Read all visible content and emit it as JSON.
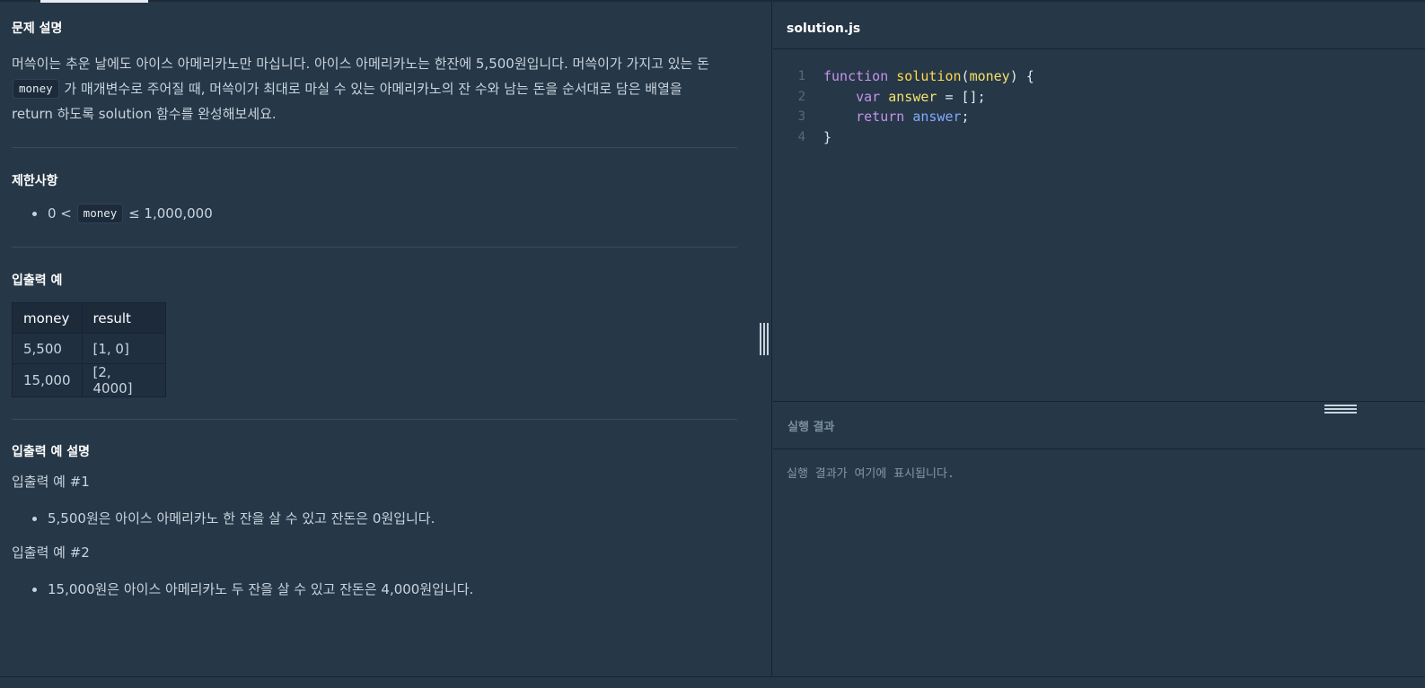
{
  "description": {
    "problem_title": "문제 설명",
    "problem_text_1": "머쓱이는 추운 날에도 아이스 아메리카노만 마십니다. 아이스 아메리카노는 한잔에 5,500원입니다. 머쓱이가 가지고 있는 돈",
    "problem_code": "money",
    "problem_text_2": "가 매개변수로 주어질 때, 머쓱이가 최대로 마실 수 있는 아메리카노의 잔 수와 남는 돈을 순서대로 담은 배열을",
    "problem_text_3": "return 하도록 solution 함수를 완성해보세요.",
    "constraints_title": "제한사항",
    "constraint_prefix": "0 <",
    "constraint_code": "money",
    "constraint_suffix": "≤ 1,000,000",
    "io_title": "입출력 예",
    "io_table": {
      "headers": [
        "money",
        "result"
      ],
      "rows": [
        [
          "5,500",
          "[1, 0]"
        ],
        [
          "15,000",
          "[2, 4000]"
        ]
      ]
    },
    "io_explain_title": "입출력 예 설명",
    "example1_title": "입출력 예 #1",
    "example1_text": "5,500원은 아이스 아메리카노 한 잔을 살 수 있고 잔돈은 0원입니다.",
    "example2_title": "입출력 예 #2",
    "example2_text": "15,000원은 아이스 아메리카노 두 잔을 살 수 있고 잔돈은 4,000원입니다."
  },
  "editor": {
    "filename": "solution.js",
    "line_numbers": [
      "1",
      "2",
      "3",
      "4"
    ],
    "line1": {
      "kw": "function",
      "fn": "solution",
      "p_open": "(",
      "param": "money",
      "p_close": ") {"
    },
    "line2": {
      "indent": "    ",
      "kw": "var",
      "name": "answer",
      "rest": " = [];"
    },
    "line3": {
      "indent": "    ",
      "kw": "return",
      "name": "answer",
      "rest": ";"
    },
    "line4": {
      "text": "}"
    }
  },
  "result": {
    "title": "실행 결과",
    "placeholder": "실행 결과가 여기에 표시됩니다."
  },
  "colors": {
    "background": "#263747",
    "keyword": "#c792ea",
    "function_name": "#ffd84d",
    "identifier": "#82aaff"
  }
}
